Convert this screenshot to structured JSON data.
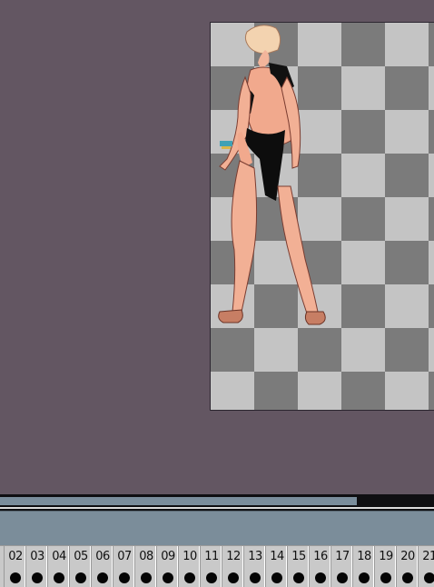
{
  "timeline": {
    "frames": [
      "02",
      "03",
      "04",
      "05",
      "06",
      "07",
      "08",
      "09",
      "10",
      "11",
      "12",
      "13",
      "14",
      "15",
      "16",
      "17",
      "18",
      "19",
      "20",
      "21"
    ]
  },
  "colors": {
    "background": "#635662",
    "checker_dark": "#7b7b7b",
    "checker_light": "#c4c4c4",
    "scroll_thumb": "#7a8d9c",
    "panel": "#7b8d9a",
    "keyframe_dot": "#050505"
  },
  "icons": {
    "keyframe": "filled-circle"
  }
}
